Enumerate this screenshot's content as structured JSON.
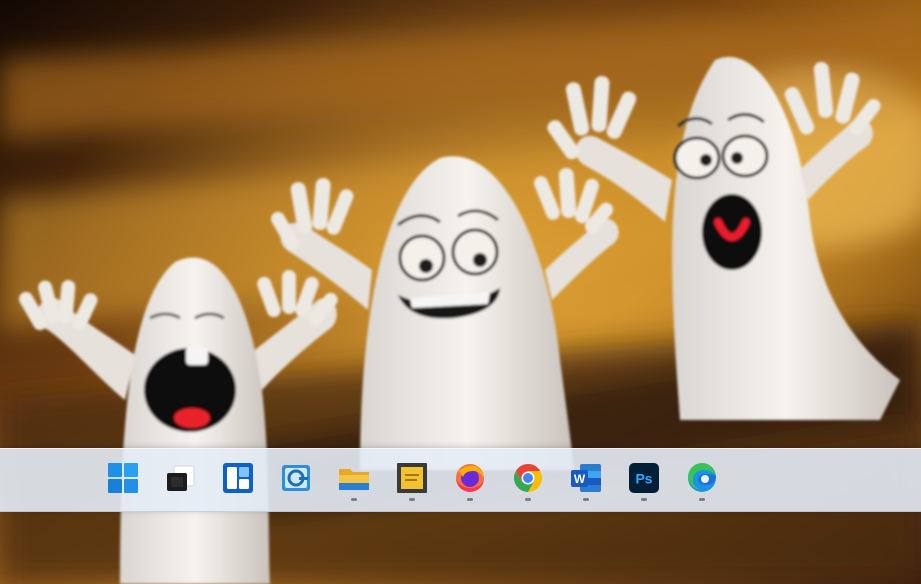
{
  "taskbar": {
    "items": [
      {
        "name": "Start",
        "icon": "windows-start-icon",
        "running": false
      },
      {
        "name": "Task View",
        "icon": "task-view-icon",
        "running": false
      },
      {
        "name": "Widgets",
        "icon": "widgets-icon",
        "running": false
      },
      {
        "name": "Settings",
        "icon": "settings-app-icon",
        "running": false
      },
      {
        "name": "File Explorer",
        "icon": "folder-icon",
        "running": true
      },
      {
        "name": "Sticky Notes",
        "icon": "sticky-notes-icon",
        "running": true
      },
      {
        "name": "Firefox",
        "icon": "firefox-icon",
        "running": true
      },
      {
        "name": "Google Chrome",
        "icon": "chrome-icon",
        "running": true
      },
      {
        "name": "Microsoft Word",
        "icon": "word-icon",
        "running": true
      },
      {
        "name": "Adobe Photoshop",
        "icon": "photoshop-icon",
        "running": true
      },
      {
        "name": "Microsoft Edge",
        "icon": "edge-icon",
        "running": true
      }
    ],
    "labels": {
      "word_letter": "W",
      "photoshop_text": "Ps"
    }
  },
  "colors": {
    "taskbar_bg": "#e4ecf6",
    "start_blue": "#1e90e8",
    "word_blue": "#185abd",
    "photoshop_bg": "#001e36",
    "photoshop_text": "#31a8ff",
    "folder_yellow": "#f6c445"
  }
}
